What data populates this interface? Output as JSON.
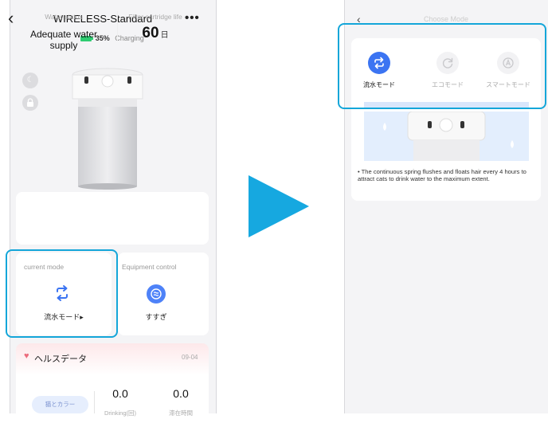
{
  "left_screen": {
    "title": "WIRELESS-Standard",
    "back_glyph": "‹",
    "more_glyph": "•••",
    "battery": {
      "percent": "35%",
      "state": "Charging",
      "color": "#2ecc71"
    },
    "water_card": {
      "water_status_label": "Water status",
      "water_status_value": "Adequate water supply",
      "filter_label": "Filter cartridge life",
      "filter_value": "60",
      "filter_unit": "日"
    },
    "mode_card": {
      "label": "current mode",
      "value": "流水モード▸",
      "icon": "loop-arrows-icon"
    },
    "control_card": {
      "label": "Equipment control",
      "value": "すすぎ",
      "icon": "rinse-icon"
    },
    "health": {
      "title": "ヘルスデータ",
      "date": "09-04",
      "cat_color_button": "猫とカラー",
      "drinking_value": "0.0",
      "drinking_label": "Drinking(回)",
      "stay_value": "0.0",
      "stay_label": "滞在時間"
    }
  },
  "right_screen": {
    "back_glyph": "‹",
    "title": "Choose Mode",
    "modes": [
      {
        "label": "流水モード",
        "active": true,
        "icon": "loop-arrows-icon"
      },
      {
        "label": "エコモード",
        "active": false,
        "icon": "eco-refresh-icon"
      },
      {
        "label": "スマートモード",
        "active": false,
        "icon": "smart-a-icon"
      }
    ],
    "description": "The continuous spring flushes and floats hair every 4 hours to attract cats to drink water to the maximum extent."
  },
  "colors": {
    "highlight": "#14a6d9",
    "accent_blue": "#3b74f2",
    "arrow": "#16a8e0"
  }
}
